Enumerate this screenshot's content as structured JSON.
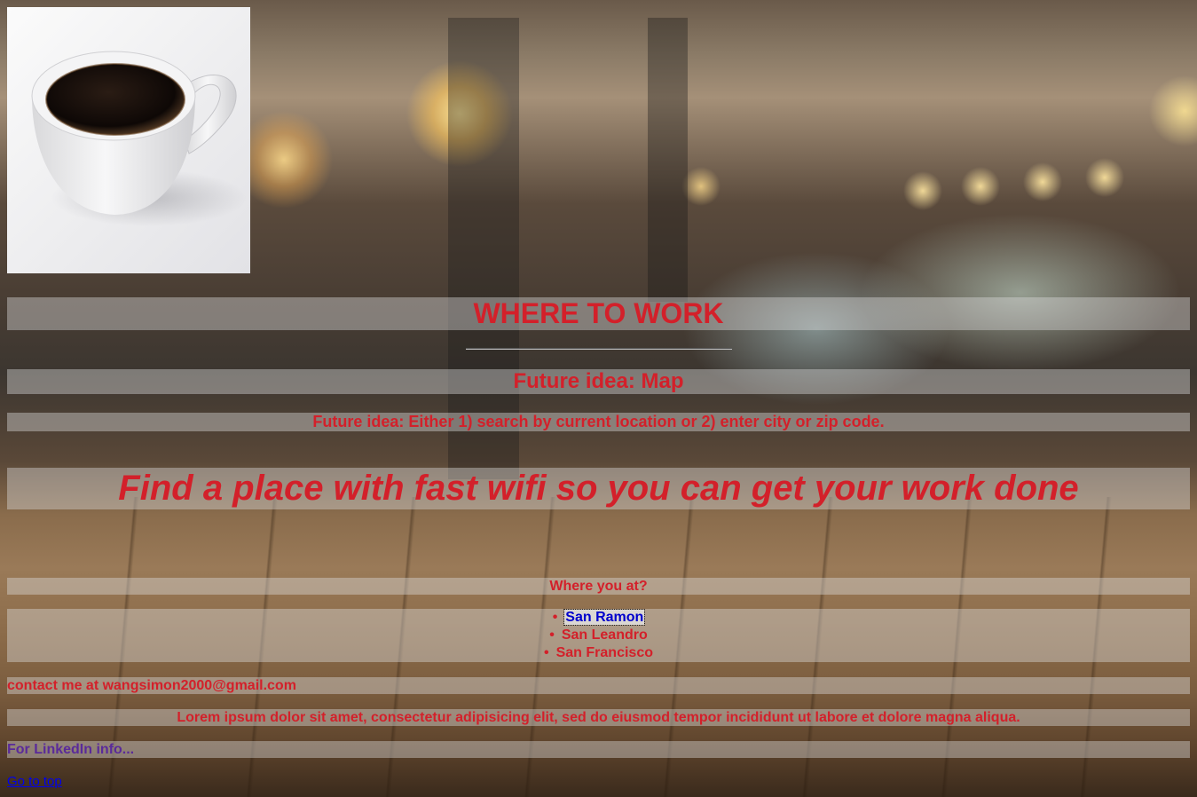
{
  "header": {
    "title": "WHERE TO WORK",
    "logo_icon": "coffee-cup-icon"
  },
  "main": {
    "map_heading": "Future idea: Map",
    "search_text": "Future idea: Either 1) search by current location or 2) enter city or zip code.",
    "tagline": "Find a place with fast wifi so you can get your work done",
    "where_heading": "Where you at?",
    "cities": [
      {
        "label": "San Ramon",
        "active": true
      },
      {
        "label": "San Leandro",
        "active": false
      },
      {
        "label": "San Francisco",
        "active": false
      }
    ]
  },
  "footer": {
    "contact": "contact me at wangsimon2000@gmail.com",
    "lorem": "Lorem ipsum dolor sit amet, consectetur adipisicing elit, sed do eiusmod tempor incididunt ut labore et dolore magna aliqua.",
    "linkedin": "For LinkedIn info...",
    "go_to_top": "Go to top"
  },
  "colors": {
    "text": "#d3202a",
    "link": "#0000ee",
    "visited": "#5a2a9a",
    "band": "rgba(220,220,220,0.42)"
  }
}
